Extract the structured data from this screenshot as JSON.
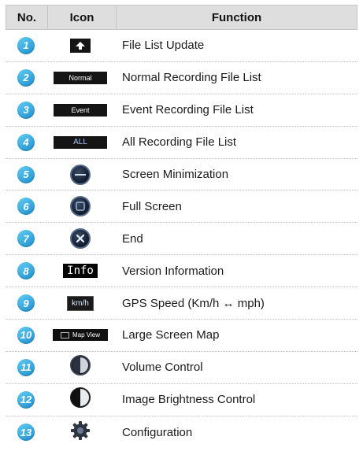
{
  "header": {
    "no": "No.",
    "icon": "Icon",
    "function": "Function"
  },
  "rows": [
    {
      "no": "1",
      "icon": "upload-arrow-icon",
      "function": "File List Update"
    },
    {
      "no": "2",
      "icon_label": "Normal",
      "function": "Normal Recording File List"
    },
    {
      "no": "3",
      "icon_label": "Event",
      "function": "Event Recording File List"
    },
    {
      "no": "4",
      "icon_label": "ALL",
      "function": "All Recording File List"
    },
    {
      "no": "5",
      "icon": "minimize-icon",
      "function": "Screen Minimization"
    },
    {
      "no": "6",
      "icon": "full-screen-icon",
      "function": "Full Screen"
    },
    {
      "no": "7",
      "icon": "close-icon",
      "function": "End"
    },
    {
      "no": "8",
      "icon_label": "Info",
      "function": "Version Information"
    },
    {
      "no": "9",
      "icon_label": "km/h",
      "function": "GPS Speed (Km/h ↔ mph)"
    },
    {
      "no": "10",
      "icon_label": "Map View",
      "function": "Large Screen Map"
    },
    {
      "no": "11",
      "icon": "volume-icon",
      "function": "Volume Control"
    },
    {
      "no": "12",
      "icon": "brightness-icon",
      "function": "Image Brightness Control"
    },
    {
      "no": "13",
      "icon": "gear-icon",
      "function": "Configuration"
    }
  ]
}
